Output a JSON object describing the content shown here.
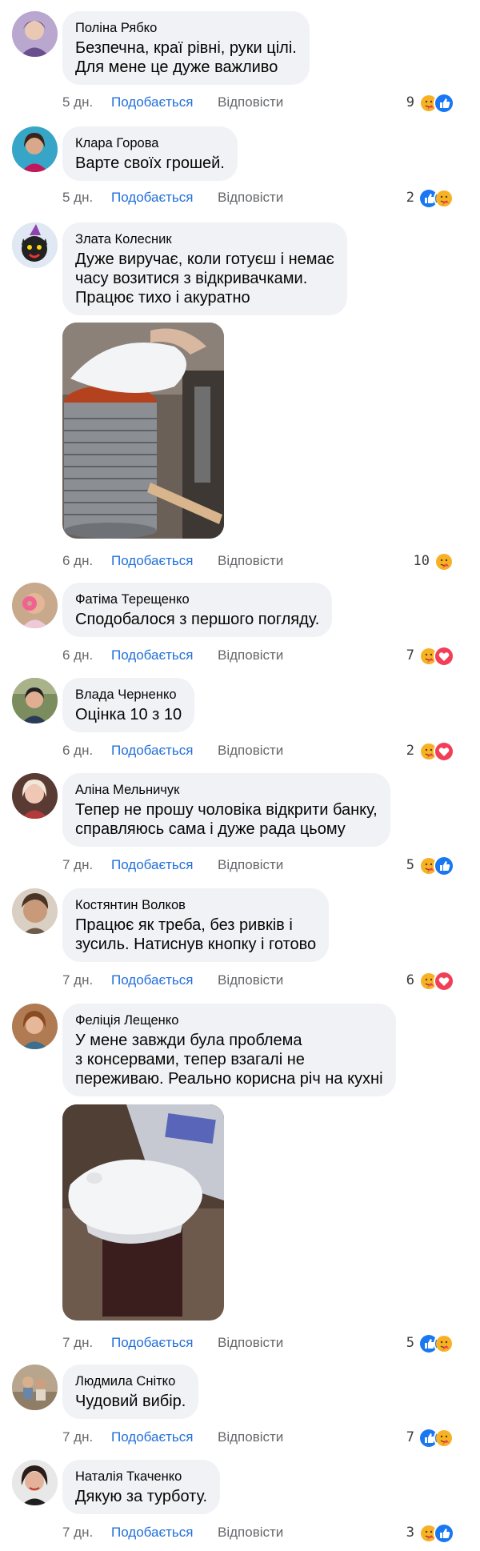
{
  "labels": {
    "like": "Подобається",
    "reply": "Відповісти"
  },
  "colors": {
    "like_blue": "#216fdb",
    "bubble_bg": "#f0f2f5",
    "meta_gray": "#65676b"
  },
  "comments": [
    {
      "author": "Поліна Рябко",
      "lines": [
        "Безпечна, краї рівні, руки цілі.",
        "Для мене це дуже важливо"
      ],
      "time": "5 дн.",
      "count": "9",
      "reactions": [
        "care-icon",
        "like-icon"
      ]
    },
    {
      "author": "Клара Горова",
      "lines": [
        "Варте своїх грошей."
      ],
      "time": "5 дн.",
      "count": "2",
      "reactions": [
        "like-icon",
        "care-icon"
      ]
    },
    {
      "author": "Злата Колесник",
      "lines": [
        "Дуже виручає, коли готуєш і немає",
        "часу возитися з відкривачками.",
        "Працює тихо і акуратно"
      ],
      "time": "6 дн.",
      "count": "10",
      "reactions": [
        "care-icon"
      ],
      "photo": "can-opener-photo"
    },
    {
      "author": "Фатіма Терещенко",
      "lines": [
        "Сподобалося з першого погляду."
      ],
      "time": "6 дн.",
      "count": "7",
      "reactions": [
        "care-icon",
        "love-icon"
      ]
    },
    {
      "author": "Влада Черненко",
      "lines": [
        "Оцінка 10 з 10"
      ],
      "time": "6 дн.",
      "count": "2",
      "reactions": [
        "care-icon",
        "love-icon"
      ]
    },
    {
      "author": "Аліна Мельничук",
      "lines": [
        "Тепер не прошу чоловіка відкрити банку,",
        "справляюсь сама і дуже рада цьому"
      ],
      "time": "7 дн.",
      "count": "5",
      "reactions": [
        "care-icon",
        "like-icon"
      ]
    },
    {
      "author": "Костянтин Волков",
      "lines": [
        "Працює як треба, без ривків і",
        "зусиль. Натиснув кнопку і готово"
      ],
      "time": "7 дн.",
      "count": "6",
      "reactions": [
        "care-icon",
        "love-icon"
      ]
    },
    {
      "author": "Феліція Лещенко",
      "lines": [
        "У мене завжди була проблема",
        "з консервами, тепер взагалі не",
        "переживаю. Реально корисна річ на кухні"
      ],
      "time": "7 дн.",
      "count": "5",
      "reactions": [
        "like-icon",
        "care-icon"
      ],
      "photo": "can-opener-photo-2"
    },
    {
      "author": "Людмила Снітко",
      "lines": [
        "Чудовий вибір."
      ],
      "time": "7 дн.",
      "count": "7",
      "reactions": [
        "like-icon",
        "care-icon"
      ]
    },
    {
      "author": "Наталія Ткаченко",
      "lines": [
        "Дякую за турботу."
      ],
      "time": "7 дн.",
      "count": "3",
      "reactions": [
        "care-icon",
        "like-icon"
      ]
    }
  ]
}
